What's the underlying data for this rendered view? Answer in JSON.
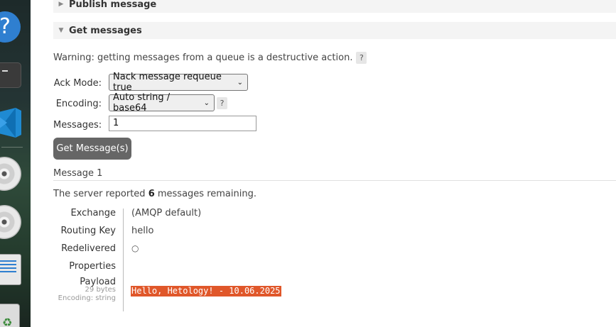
{
  "dock": {
    "items": [
      "help-icon",
      "terminal-icon",
      "vscode-icon",
      "disc-icon",
      "disc-icon",
      "drive-icon",
      "trash-icon"
    ],
    "help_glyph": "?"
  },
  "sections": {
    "publish": {
      "title": "Publish message",
      "expanded": false
    },
    "get": {
      "title": "Get messages",
      "expanded": true
    }
  },
  "warning": {
    "text": "Warning: getting messages from a queue is a destructive action.",
    "help": "?"
  },
  "form": {
    "ack_mode_label": "Ack Mode:",
    "ack_mode_value": "Nack message requeue true",
    "encoding_label": "Encoding:",
    "encoding_value": "Auto string / base64",
    "encoding_help": "?",
    "messages_label": "Messages:",
    "messages_value": "1",
    "submit_label": "Get Message(s)"
  },
  "result": {
    "title": "Message 1",
    "remaining_prefix": "The server reported ",
    "remaining_count": "6",
    "remaining_suffix": " messages remaining.",
    "fields": {
      "exchange_label": "Exchange",
      "exchange_value": "(AMQP default)",
      "routing_key_label": "Routing Key",
      "routing_key_value": "hello",
      "redelivered_label": "Redelivered",
      "redelivered_value": "○",
      "properties_label": "Properties",
      "payload_label": "Payload",
      "payload_size": "29 bytes",
      "payload_encoding": "Encoding: string",
      "payload_value": "Hello, Hetology! - 10.06.2025"
    }
  },
  "colors": {
    "payload_highlight": "#e0572a",
    "button_bg": "#666666",
    "section_bg": "#f4f4f4"
  }
}
